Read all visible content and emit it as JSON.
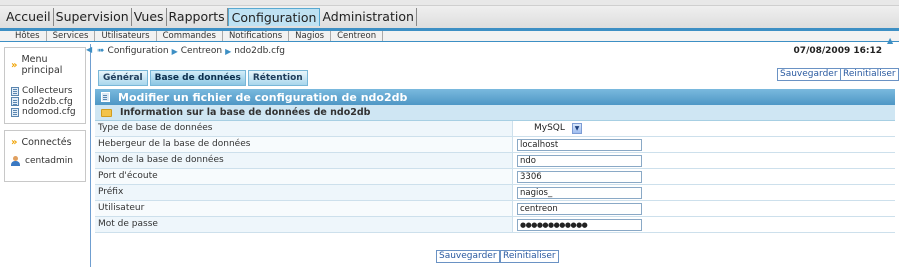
{
  "top_menu": [
    "Accueil",
    "Supervision",
    "Vues",
    "Rapports",
    "Configuration",
    "Administration"
  ],
  "top_menu_active": "Configuration",
  "sub_menu": [
    "Hôtes",
    "Services",
    "Utilisateurs",
    "Commandes",
    "Notifications",
    "Nagios",
    "Centreon"
  ],
  "sidebar": {
    "menu_title": "Menu principal",
    "items": [
      "Collecteurs",
      "ndo2db.cfg",
      "ndomod.cfg"
    ],
    "connected_title": "Connectés",
    "users": [
      "centadmin"
    ]
  },
  "breadcrumb": [
    "Configuration",
    "Centreon",
    "ndo2db.cfg"
  ],
  "datetime": "07/08/2009 16:12",
  "buttons": {
    "save": "Sauvegarder",
    "reset": "Reinitialiser"
  },
  "tabs": [
    "Général",
    "Base de données",
    "Rétention"
  ],
  "active_tab": "Base de données",
  "form": {
    "title": "Modifier un fichier de configuration de ndo2db",
    "section": "Information sur la base de données de ndo2db",
    "rows": [
      {
        "label": "Type de base de données",
        "value": "MySQL",
        "type": "select"
      },
      {
        "label": "Hebergeur de la base de données",
        "value": "localhost",
        "type": "text"
      },
      {
        "label": "Nom de la base de données",
        "value": "ndo",
        "type": "text"
      },
      {
        "label": "Port d'écoute",
        "value": "3306",
        "type": "text"
      },
      {
        "label": "Préfix",
        "value": "nagios_",
        "type": "text"
      },
      {
        "label": "Utilisateur",
        "value": "centreon",
        "type": "text"
      },
      {
        "label": "Mot de passe",
        "value": "●●●●●●●●●●●●",
        "type": "password"
      }
    ]
  },
  "colors": {
    "accent": "#3d8fc4",
    "header": "#4e97c5",
    "active_tab_bg": "#bfe2f3"
  },
  "icons": {
    "menu_chevron": "double-chevron-icon",
    "file": "file-icon",
    "folder": "folder-icon",
    "user": "user-icon",
    "dropdown": "chevron-down-icon"
  }
}
